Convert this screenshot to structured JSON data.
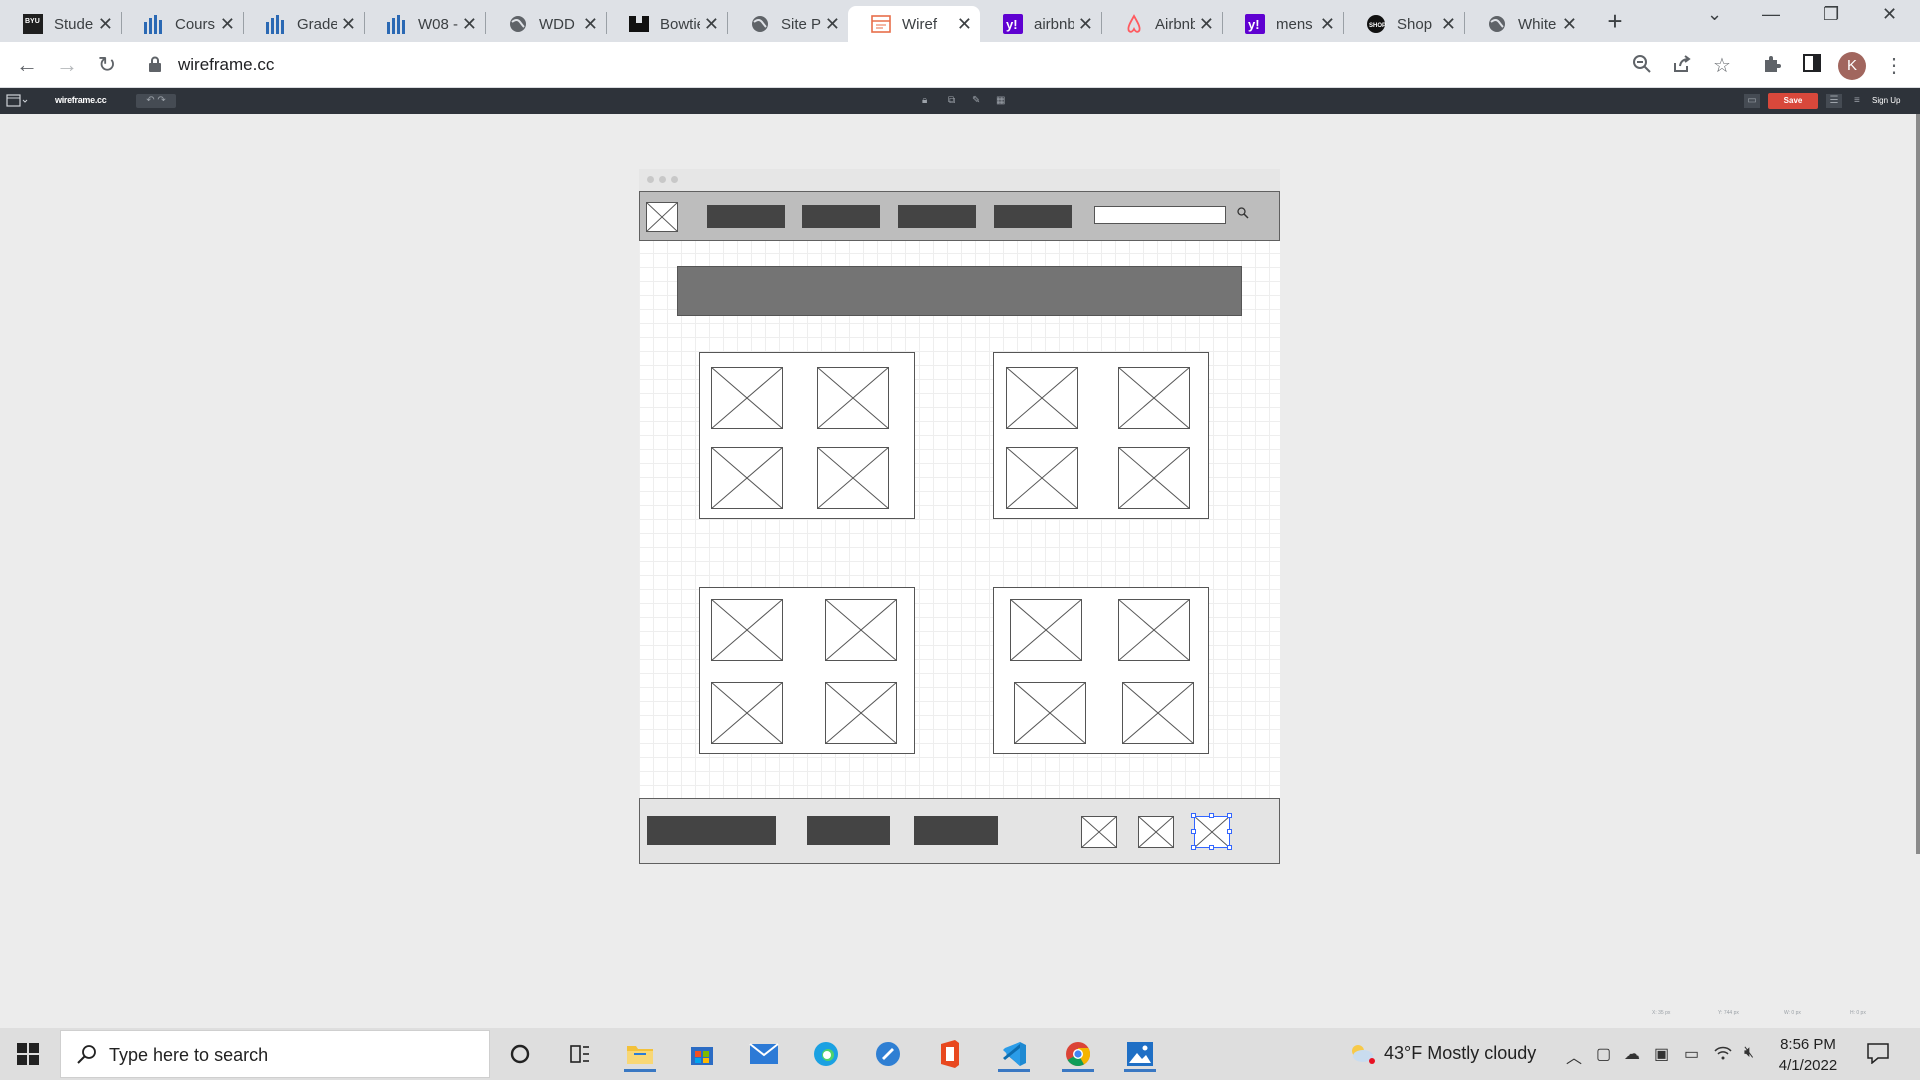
{
  "browser": {
    "tabs": [
      {
        "title": "Student",
        "icon": "byu-icon"
      },
      {
        "title": "Courses",
        "icon": "canvas-chart-icon"
      },
      {
        "title": "Grades",
        "icon": "canvas-chart-icon"
      },
      {
        "title": "W08 -",
        "icon": "canvas-chart-icon"
      },
      {
        "title": "WDD",
        "icon": "globe-icon"
      },
      {
        "title": "Bowtie",
        "icon": "bowtie-icon"
      },
      {
        "title": "Site Pl",
        "icon": "globe-icon"
      },
      {
        "title": "Wiref",
        "icon": "wireframe-icon"
      },
      {
        "title": "airbnb",
        "icon": "yahoo-icon"
      },
      {
        "title": "Airbnb",
        "icon": "airbnb-icon"
      },
      {
        "title": "mens",
        "icon": "yahoo-icon"
      },
      {
        "title": "Shop",
        "icon": "shop-icon"
      },
      {
        "title": "White",
        "icon": "globe-icon"
      }
    ],
    "active_tab": 7,
    "close_glyph": "✕",
    "new_tab": "+",
    "url": "wireframe.cc",
    "profile_initial": "K",
    "window_controls": {
      "chevron": "⌄",
      "minimize": "—",
      "restore": "❐",
      "close": "✕"
    }
  },
  "wireframe_app": {
    "logo": "wireframe.cc",
    "save_label": "Save",
    "signup_label": "Sign Up",
    "coords": [
      "X: 35 px",
      "Y: 744 px",
      "W: 0 px",
      "H: 0 px"
    ]
  },
  "taskbar": {
    "search_placeholder": "Type here to search",
    "weather": "43°F  Mostly cloudy",
    "time": "8:56 PM",
    "date": "4/1/2022"
  },
  "colors": {
    "accent_save": "#d8483b",
    "wf_dark": "#444444",
    "wf_hero": "#747474",
    "selection": "#3366ff"
  }
}
